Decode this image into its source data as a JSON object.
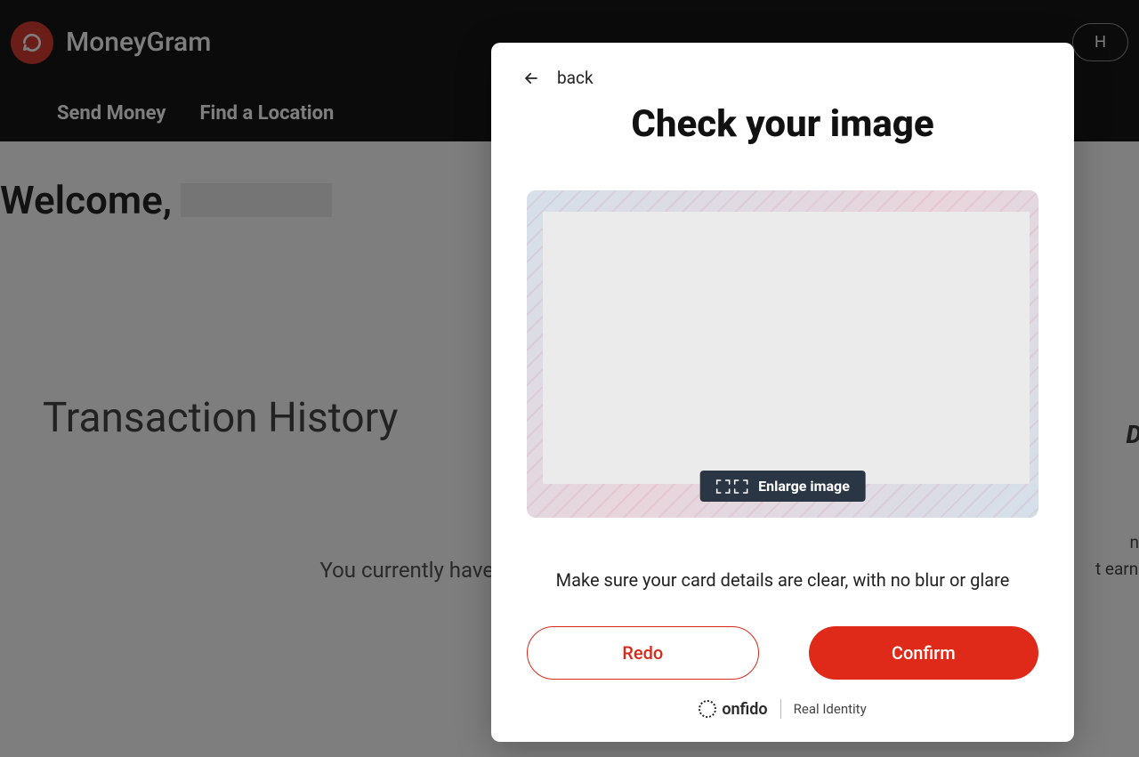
{
  "header": {
    "brand": "MoneyGram",
    "help": "H"
  },
  "nav": {
    "send": "Send Money",
    "find": "Find a Location"
  },
  "welcome": {
    "prefix": "Welcome, "
  },
  "history": {
    "title": "Transaction History",
    "empty": "You currently have no tra"
  },
  "promo": {
    "headline": "+\nDS",
    "line1": "ntil:",
    "line2": "t earned"
  },
  "modal": {
    "back": "back",
    "title": "Check your image",
    "enlarge": "Enlarge image",
    "instruction": "Make sure your card details are clear, with no blur or glare",
    "redo": "Redo",
    "confirm": "Confirm",
    "onfido": "onfido",
    "real_identity": "Real Identity"
  },
  "colors": {
    "primary": "#E02A19",
    "brand_red": "#D4291C"
  }
}
